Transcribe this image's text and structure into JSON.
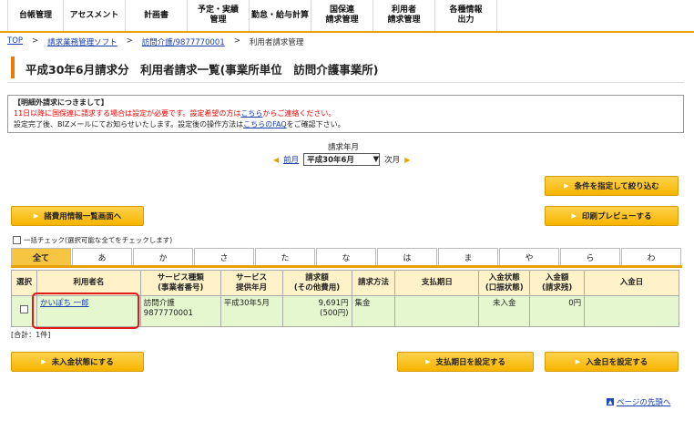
{
  "nav": {
    "tabs": [
      {
        "label": "台帳管理",
        "w": 62
      },
      {
        "label": "アセスメント",
        "w": 68
      },
      {
        "label": "計画書",
        "w": 68
      },
      {
        "label": "予定・実績\n管理",
        "w": 68
      },
      {
        "label": "勤怠・給与計算",
        "w": 68
      },
      {
        "label": "国保連\n請求管理",
        "w": 68
      },
      {
        "label": "利用者\n請求管理",
        "w": 68
      },
      {
        "label": "各種情報\n出力",
        "w": 68
      }
    ]
  },
  "breadcrumb": {
    "top": "TOP",
    "sep": ">",
    "item1": "請求業務管理ソフト",
    "item2": "訪問介護/9877770001",
    "current": "利用者請求管理"
  },
  "page_title": "平成30年6月請求分　利用者請求一覧(事業所単位　訪問介護事業所)",
  "notice": {
    "heading": "【明細外請求につきまして】",
    "line1_pre": "11日以降に国保連に請求する場合は設定が必要です。設定希望の方は",
    "line1_link": "こちら",
    "line1_post": "からご連絡ください。",
    "line2_pre": "設定完了後、BIZメールにてお知らせいたします。設定後の操作方法は",
    "line2_link": "こちらのFAQ",
    "line2_post": "をご確認下さい。"
  },
  "period": {
    "label": "請求年月",
    "prev": "前月",
    "selected": "平成30年6月",
    "next": "次月"
  },
  "buttons": {
    "filter": "条件を指定して絞り込む",
    "expense_list": "諸費用情報一覧画面へ",
    "print_preview": "印刷プレビューする",
    "set_unpaid": "未入金状態にする",
    "set_due_date": "支払期日を設定する",
    "set_payment_date": "入金日を設定する"
  },
  "bulk_check_label": "一括チェック(選択可能な全てをチェックします)",
  "kana_tabs": [
    "全て",
    "あ",
    "か",
    "さ",
    "た",
    "な",
    "は",
    "ま",
    "や",
    "ら",
    "わ"
  ],
  "table": {
    "headers": [
      "選択",
      "利用者名",
      "サービス種類\n(事業者番号)",
      "サービス\n提供年月",
      "請求額\n(その他費用)",
      "請求方法",
      "支払期日",
      "入金状態\n(口振状態)",
      "入金額\n(請求残)",
      "入金日"
    ],
    "rows": [
      {
        "name": "かいぽち 一郎",
        "service_type": "訪問介護",
        "provider_no": "9877770001",
        "month": "平成30年5月",
        "amount": "9,691円",
        "other": "(500円)",
        "method": "集金",
        "due": "",
        "status": "未入金",
        "paid": "0円",
        "paid_date": ""
      }
    ]
  },
  "total_label": "[合計：1件]",
  "to_top": "ページの先頭へ"
}
